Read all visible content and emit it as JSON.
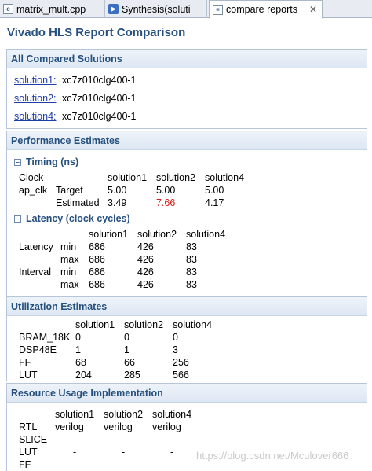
{
  "tabs": [
    {
      "label": "matrix_mult.cpp",
      "icon": "cpp-file-icon"
    },
    {
      "label": "Synthesis(soluti",
      "icon": "synthesis-icon"
    },
    {
      "label": "compare reports",
      "icon": "compare-icon",
      "close": "✕"
    }
  ],
  "page_title": "Vivado HLS Report Comparison",
  "compared": {
    "title": "All Compared Solutions",
    "items": [
      {
        "name": "solution1:",
        "part": "xc7z010clg400-1"
      },
      {
        "name": "solution2:",
        "part": "xc7z010clg400-1"
      },
      {
        "name": "solution4:",
        "part": "xc7z010clg400-1"
      }
    ]
  },
  "performance": {
    "title": "Performance Estimates",
    "timing": {
      "title": "Timing (ns)",
      "clock_label": "Clock",
      "clock_name": "ap_clk",
      "headers": [
        "solution1",
        "solution2",
        "solution4"
      ],
      "rows": [
        {
          "label": "Target",
          "values": [
            "5.00",
            "5.00",
            "5.00"
          ]
        },
        {
          "label": "Estimated",
          "values": [
            "3.49",
            "7.66",
            "4.17"
          ]
        }
      ]
    },
    "latency": {
      "title": "Latency (clock cycles)",
      "headers": [
        "solution1",
        "solution2",
        "solution4"
      ],
      "groups": [
        {
          "label": "Latency",
          "rows": [
            {
              "label": "min",
              "values": [
                "686",
                "426",
                "83"
              ]
            },
            {
              "label": "max",
              "values": [
                "686",
                "426",
                "83"
              ]
            }
          ]
        },
        {
          "label": "Interval",
          "rows": [
            {
              "label": "min",
              "values": [
                "686",
                "426",
                "83"
              ]
            },
            {
              "label": "max",
              "values": [
                "686",
                "426",
                "83"
              ]
            }
          ]
        }
      ]
    }
  },
  "utilization": {
    "title": "Utilization Estimates",
    "headers": [
      "solution1",
      "solution2",
      "solution4"
    ],
    "rows": [
      {
        "label": "BRAM_18K",
        "values": [
          "0",
          "0",
          "0"
        ]
      },
      {
        "label": "DSP48E",
        "values": [
          "1",
          "1",
          "3"
        ]
      },
      {
        "label": "FF",
        "values": [
          "68",
          "66",
          "256"
        ]
      },
      {
        "label": "LUT",
        "values": [
          "204",
          "285",
          "566"
        ]
      }
    ]
  },
  "resource": {
    "title": "Resource Usage Implementation",
    "headers": [
      "solution1",
      "solution2",
      "solution4"
    ],
    "rtl_label": "RTL",
    "rtl_values": [
      "verilog",
      "verilog",
      "verilog"
    ],
    "rows": [
      {
        "label": "SLICE",
        "values": [
          "-",
          "-",
          "-"
        ]
      },
      {
        "label": "LUT",
        "values": [
          "-",
          "-",
          "-"
        ]
      },
      {
        "label": "FF",
        "values": [
          "-",
          "-",
          "-"
        ]
      }
    ]
  },
  "watermark": "https://blog.csdn.net/Mculover666",
  "colors": {
    "heading": "#26507e",
    "link": "#1e3ea8",
    "violation": "#d42020"
  }
}
